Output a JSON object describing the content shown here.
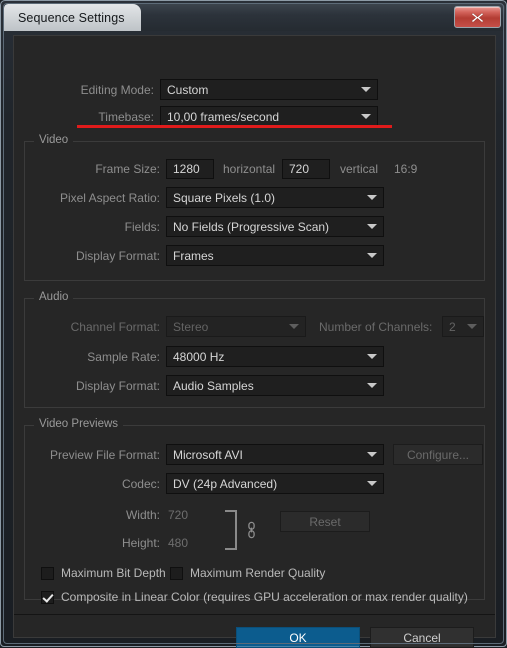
{
  "window": {
    "title": "Sequence Settings",
    "close_icon": "close-icon",
    "close_glyph": "x"
  },
  "top": {
    "editing_mode": {
      "label": "Editing Mode:",
      "value": "Custom"
    },
    "timebase": {
      "label": "Timebase:",
      "value": "10,00 frames/second"
    }
  },
  "video": {
    "title": "Video",
    "frame_size": {
      "label": "Frame Size:",
      "horizontal_value": "1280",
      "horizontal_label": "horizontal",
      "vertical_value": "720",
      "vertical_label": "vertical",
      "aspect": "16:9"
    },
    "pixel_aspect_ratio": {
      "label": "Pixel Aspect Ratio:",
      "value": "Square Pixels (1.0)"
    },
    "fields": {
      "label": "Fields:",
      "value": "No Fields (Progressive Scan)"
    },
    "display_format": {
      "label": "Display Format:",
      "value": "Frames"
    }
  },
  "audio": {
    "title": "Audio",
    "channel_format": {
      "label": "Channel Format:",
      "value": "Stereo"
    },
    "number_of_channels": {
      "label": "Number of Channels:",
      "value": "2"
    },
    "sample_rate": {
      "label": "Sample Rate:",
      "value": "48000 Hz"
    },
    "display_format": {
      "label": "Display Format:",
      "value": "Audio Samples"
    }
  },
  "video_previews": {
    "title": "Video Previews",
    "preview_file_format": {
      "label": "Preview File Format:",
      "value": "Microsoft AVI"
    },
    "configure_label": "Configure...",
    "codec": {
      "label": "Codec:",
      "value": "DV (24p Advanced)"
    },
    "width": {
      "label": "Width:",
      "value": "720"
    },
    "height": {
      "label": "Height:",
      "value": "480"
    },
    "reset_label": "Reset",
    "link_icon": "chain-link-icon"
  },
  "checkboxes": {
    "maximum_bit_depth": {
      "label": "Maximum Bit Depth",
      "checked": false
    },
    "maximum_render_quality": {
      "label": "Maximum Render Quality",
      "checked": false
    },
    "composite_linear_color": {
      "label": "Composite in Linear Color (requires GPU acceleration or max render quality)",
      "checked": true
    }
  },
  "footer": {
    "ok_label": "OK",
    "cancel_label": "Cancel"
  },
  "annotation": {
    "underline_color": "#e01b1b",
    "target": "timebase-row"
  },
  "colors": {
    "dialog_background": "#262626",
    "field_background": "#1f1f1f",
    "accent_primary": "#0c5c8e",
    "annotation_red": "#e01b1b",
    "label_text": "#8e8e8e",
    "value_text": "#d6d6d6"
  }
}
